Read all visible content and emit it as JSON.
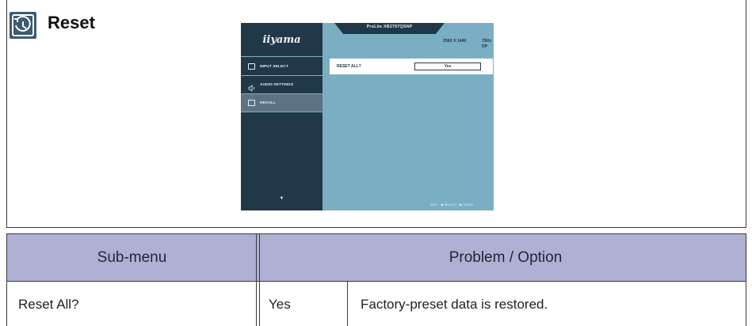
{
  "section": {
    "title": "Reset",
    "icon": "reset-recall-icon"
  },
  "osd": {
    "logo": "iiyama",
    "model": "ProLite XB2797QSNP",
    "resolution": "2560 X 1440",
    "refresh": "75Hz",
    "port": "DP",
    "menu_items": [
      {
        "label": "INPUT SELECT",
        "icon": "input-select-icon"
      },
      {
        "label": "AUDIO SETTINGS",
        "icon": "speaker-icon"
      },
      {
        "label": "RECALL",
        "icon": "recall-icon"
      }
    ],
    "active_item": "RECALL",
    "sub_label": "RESET ALL?",
    "sub_value": "Yes",
    "footer": "EXIT : ◀   SELECT : ▶/ PUSH",
    "more_indicator": "▼",
    "colors": {
      "sidebar": "#213849",
      "main": "#7aafc3",
      "active": "#5b7384"
    }
  },
  "table": {
    "header_submenu": "Sub-menu",
    "header_problem": "Problem / Option",
    "rows": [
      {
        "submenu": "Reset All?",
        "option": "Yes",
        "description": "Factory-preset data is restored."
      }
    ],
    "header_color": "#aeb1d4"
  }
}
